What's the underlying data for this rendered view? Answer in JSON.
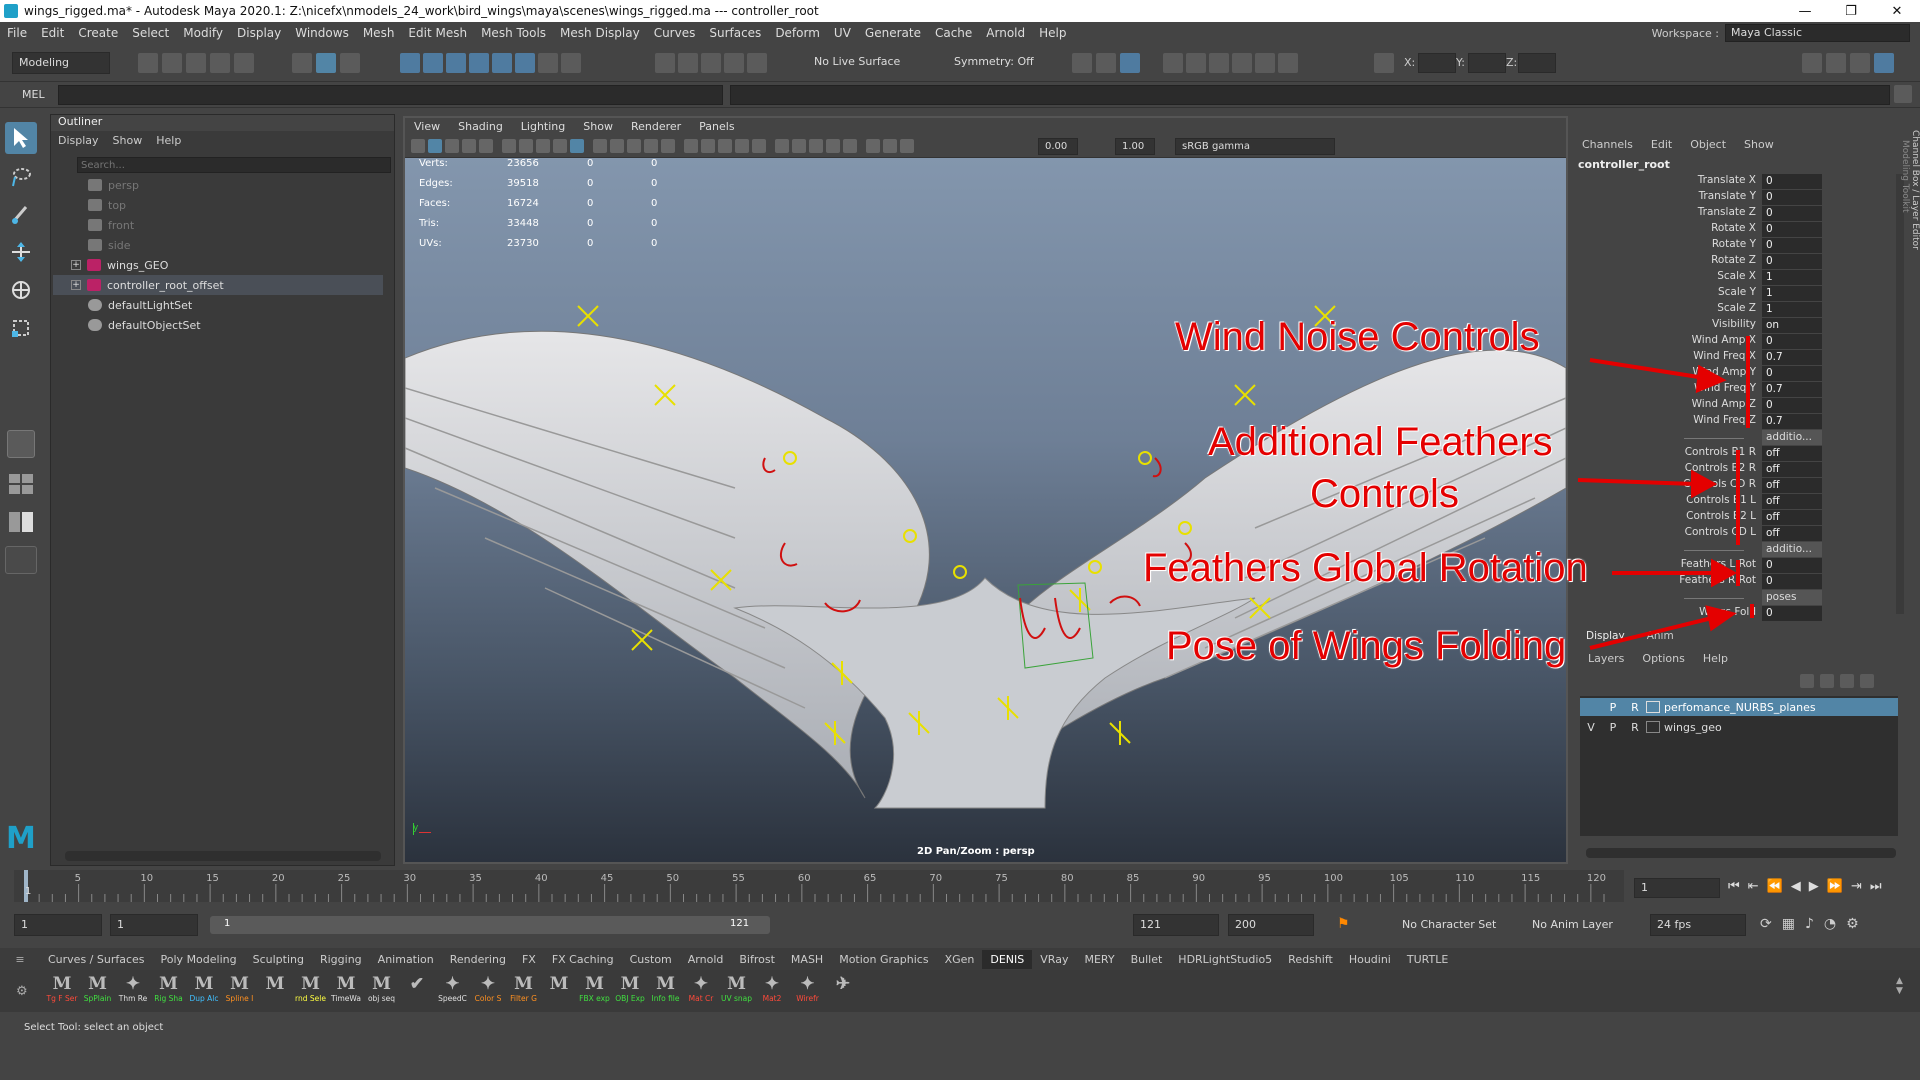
{
  "window": {
    "title": "wings_rigged.ma* - Autodesk Maya 2020.1: Z:\\nicefx\\nmodels_24_work\\bird_wings\\maya\\scenes\\wings_rigged.ma   ---   controller_root",
    "controls": [
      "—",
      "❐",
      "✕"
    ]
  },
  "menubar": {
    "items": [
      "File",
      "Edit",
      "Create",
      "Select",
      "Modify",
      "Display",
      "Windows",
      "Mesh",
      "Edit Mesh",
      "Mesh Tools",
      "Mesh Display",
      "Curves",
      "Surfaces",
      "Deform",
      "UV",
      "Generate",
      "Cache",
      "Arnold",
      "Help"
    ],
    "workspace_label": "Workspace :",
    "workspace_value": "Maya Classic"
  },
  "statusline": {
    "menuset": "Modeling",
    "live_surface": "No Live Surface",
    "symmetry": "Symmetry: Off",
    "x_label": "X:",
    "y_label": "Y:",
    "z_label": "Z:"
  },
  "mel": {
    "label": "MEL"
  },
  "outliner": {
    "title": "Outliner",
    "menu": [
      "Display",
      "Show",
      "Help"
    ],
    "search_placeholder": "Search...",
    "items": [
      {
        "label": "persp",
        "dim": true
      },
      {
        "label": "top",
        "dim": true
      },
      {
        "label": "front",
        "dim": true
      },
      {
        "label": "side",
        "dim": true
      },
      {
        "label": "wings_GEO",
        "dim": false
      },
      {
        "label": "controller_root_offset",
        "dim": false
      },
      {
        "label": "defaultLightSet",
        "dim": false
      },
      {
        "label": "defaultObjectSet",
        "dim": false
      }
    ]
  },
  "viewport": {
    "menu": [
      "View",
      "Shading",
      "Lighting",
      "Show",
      "Renderer",
      "Panels"
    ],
    "near": "0.00",
    "far": "1.00",
    "colorspace": "sRGB gamma",
    "hud": [
      {
        "label": "Verts:",
        "v1": "23656",
        "v2": "0",
        "v3": "0"
      },
      {
        "label": "Edges:",
        "v1": "39518",
        "v2": "0",
        "v3": "0"
      },
      {
        "label": "Faces:",
        "v1": "16724",
        "v2": "0",
        "v3": "0"
      },
      {
        "label": "Tris:",
        "v1": "33448",
        "v2": "0",
        "v3": "0"
      },
      {
        "label": "UVs:",
        "v1": "23730",
        "v2": "0",
        "v3": "0"
      }
    ],
    "camera_label": "2D Pan/Zoom : persp",
    "axis_y": "y",
    "axis_x": "x"
  },
  "annotations": {
    "wind": "Wind Noise Controls",
    "feathers1": "Additional Feathers",
    "feathers2": "Controls",
    "rotation": "Feathers Global Rotation",
    "pose": "Pose of Wings Folding",
    "color": "#e40000"
  },
  "channelbox": {
    "menu": [
      "Channels",
      "Edit",
      "Object",
      "Show"
    ],
    "object": "controller_root",
    "side_tab1": "Channel Box / Layer Editor",
    "side_tab2": "Modeling Toolkit",
    "rows": [
      {
        "name": "Translate X",
        "value": "0"
      },
      {
        "name": "Translate Y",
        "value": "0"
      },
      {
        "name": "Translate Z",
        "value": "0"
      },
      {
        "name": "Rotate X",
        "value": "0"
      },
      {
        "name": "Rotate Y",
        "value": "0"
      },
      {
        "name": "Rotate Z",
        "value": "0"
      },
      {
        "name": "Scale X",
        "value": "1"
      },
      {
        "name": "Scale Y",
        "value": "1"
      },
      {
        "name": "Scale Z",
        "value": "1"
      },
      {
        "name": "Visibility",
        "value": "on"
      },
      {
        "name": "Wind Amp X",
        "value": "0"
      },
      {
        "name": "Wind Freq X",
        "value": "0.7"
      },
      {
        "name": "Wind Amp Y",
        "value": "0"
      },
      {
        "name": "Wind Freq Y",
        "value": "0.7"
      },
      {
        "name": "Wind Amp Z",
        "value": "0"
      },
      {
        "name": "Wind Freq Z",
        "value": "0.7"
      },
      {
        "name": "",
        "value": "additio..."
      },
      {
        "name": "Controls B1 R",
        "value": "off"
      },
      {
        "name": "Controls B2 R",
        "value": "off"
      },
      {
        "name": "Controls CD R",
        "value": "off"
      },
      {
        "name": "Controls B1 L",
        "value": "off"
      },
      {
        "name": "Controls B2 L",
        "value": "off"
      },
      {
        "name": "Controls CD L",
        "value": "off"
      },
      {
        "name": "",
        "value": "additio..."
      },
      {
        "name": "Feathers L Rot",
        "value": "0"
      },
      {
        "name": "Feathers R Rot",
        "value": "0"
      },
      {
        "name": "",
        "value": "poses"
      },
      {
        "name": "Wings Fold",
        "value": "0"
      }
    ]
  },
  "layers": {
    "tabs": [
      "Display",
      "Anim"
    ],
    "menu": [
      "Layers",
      "Options",
      "Help"
    ],
    "items": [
      {
        "v": "",
        "p": "P",
        "r": "R",
        "name": "perfomance_NURBS_planes",
        "selected": true
      },
      {
        "v": "V",
        "p": "P",
        "r": "R",
        "name": "wings_geo",
        "selected": false
      }
    ]
  },
  "timeline": {
    "ticks": [
      "5",
      "10",
      "15",
      "20",
      "25",
      "30",
      "35",
      "40",
      "45",
      "50",
      "55",
      "60",
      "65",
      "70",
      "75",
      "80",
      "85",
      "90",
      "95",
      "100",
      "105",
      "110",
      "115",
      "120"
    ],
    "start_label": "1",
    "current_frame": "1"
  },
  "range": {
    "start": "1",
    "anim_start": "1",
    "slider_start": "1",
    "slider_end": "121",
    "anim_end": "121",
    "end": "200",
    "character_set": "No Character Set",
    "anim_layer": "No Anim Layer",
    "fps": "24 fps"
  },
  "shelf": {
    "tabs": [
      "Curves / Surfaces",
      "Poly Modeling",
      "Sculpting",
      "Rigging",
      "Animation",
      "Rendering",
      "FX",
      "FX Caching",
      "Custom",
      "Arnold",
      "Bifrost",
      "MASH",
      "Motion Graphics",
      "XGen",
      "DENIS",
      "VRay",
      "MERY",
      "Bullet",
      "HDRLightStudio5",
      "Redshift",
      "Houdini",
      "TURTLE"
    ],
    "active_tab": "DENIS",
    "buttons": [
      {
        "label": "Tg F Ser",
        "color": "#ff4a3a",
        "glyph": "M"
      },
      {
        "label": "SpPlain",
        "color": "#40e040",
        "glyph": "M"
      },
      {
        "label": "Thm Re",
        "color": "#e0e0e0",
        "glyph": "✦"
      },
      {
        "label": "Rig Sha",
        "color": "#40e040",
        "glyph": "M"
      },
      {
        "label": "Dup Alc",
        "color": "#40c0ff",
        "glyph": "M"
      },
      {
        "label": "Spline I",
        "color": "#ff9020",
        "glyph": "M"
      },
      {
        "label": "",
        "color": "#e0e0e0",
        "glyph": "M"
      },
      {
        "label": "rnd Sele",
        "color": "#ffff40",
        "glyph": "M"
      },
      {
        "label": "TimeWa",
        "color": "#e0e0e0",
        "glyph": "M"
      },
      {
        "label": "obj seq",
        "color": "#e0e0e0",
        "glyph": "M"
      },
      {
        "label": "",
        "color": "#e0e0e0",
        "glyph": "✔"
      },
      {
        "label": "SpeedC",
        "color": "#e0e0e0",
        "glyph": "✦"
      },
      {
        "label": "Color S",
        "color": "#ff9020",
        "glyph": "✦"
      },
      {
        "label": "Filter G",
        "color": "#ff9020",
        "glyph": "M"
      },
      {
        "label": "",
        "color": "#e0e0e0",
        "glyph": "M"
      },
      {
        "label": "FBX exp",
        "color": "#40e040",
        "glyph": "M"
      },
      {
        "label": "OBJ Exp",
        "color": "#40e040",
        "glyph": "M"
      },
      {
        "label": "Info file",
        "color": "#40e040",
        "glyph": "M"
      },
      {
        "label": "Mat Cr",
        "color": "#ff4a3a",
        "glyph": "✦"
      },
      {
        "label": "UV snap",
        "color": "#40e040",
        "glyph": "M"
      },
      {
        "label": "Mat2",
        "color": "#ff4a3a",
        "glyph": "✦"
      },
      {
        "label": "Wirefr",
        "color": "#ff4a3a",
        "glyph": "✦"
      },
      {
        "label": "",
        "color": "#e0e0e0",
        "glyph": "✈"
      }
    ]
  },
  "helpline": {
    "text": "Select Tool: select an object"
  }
}
